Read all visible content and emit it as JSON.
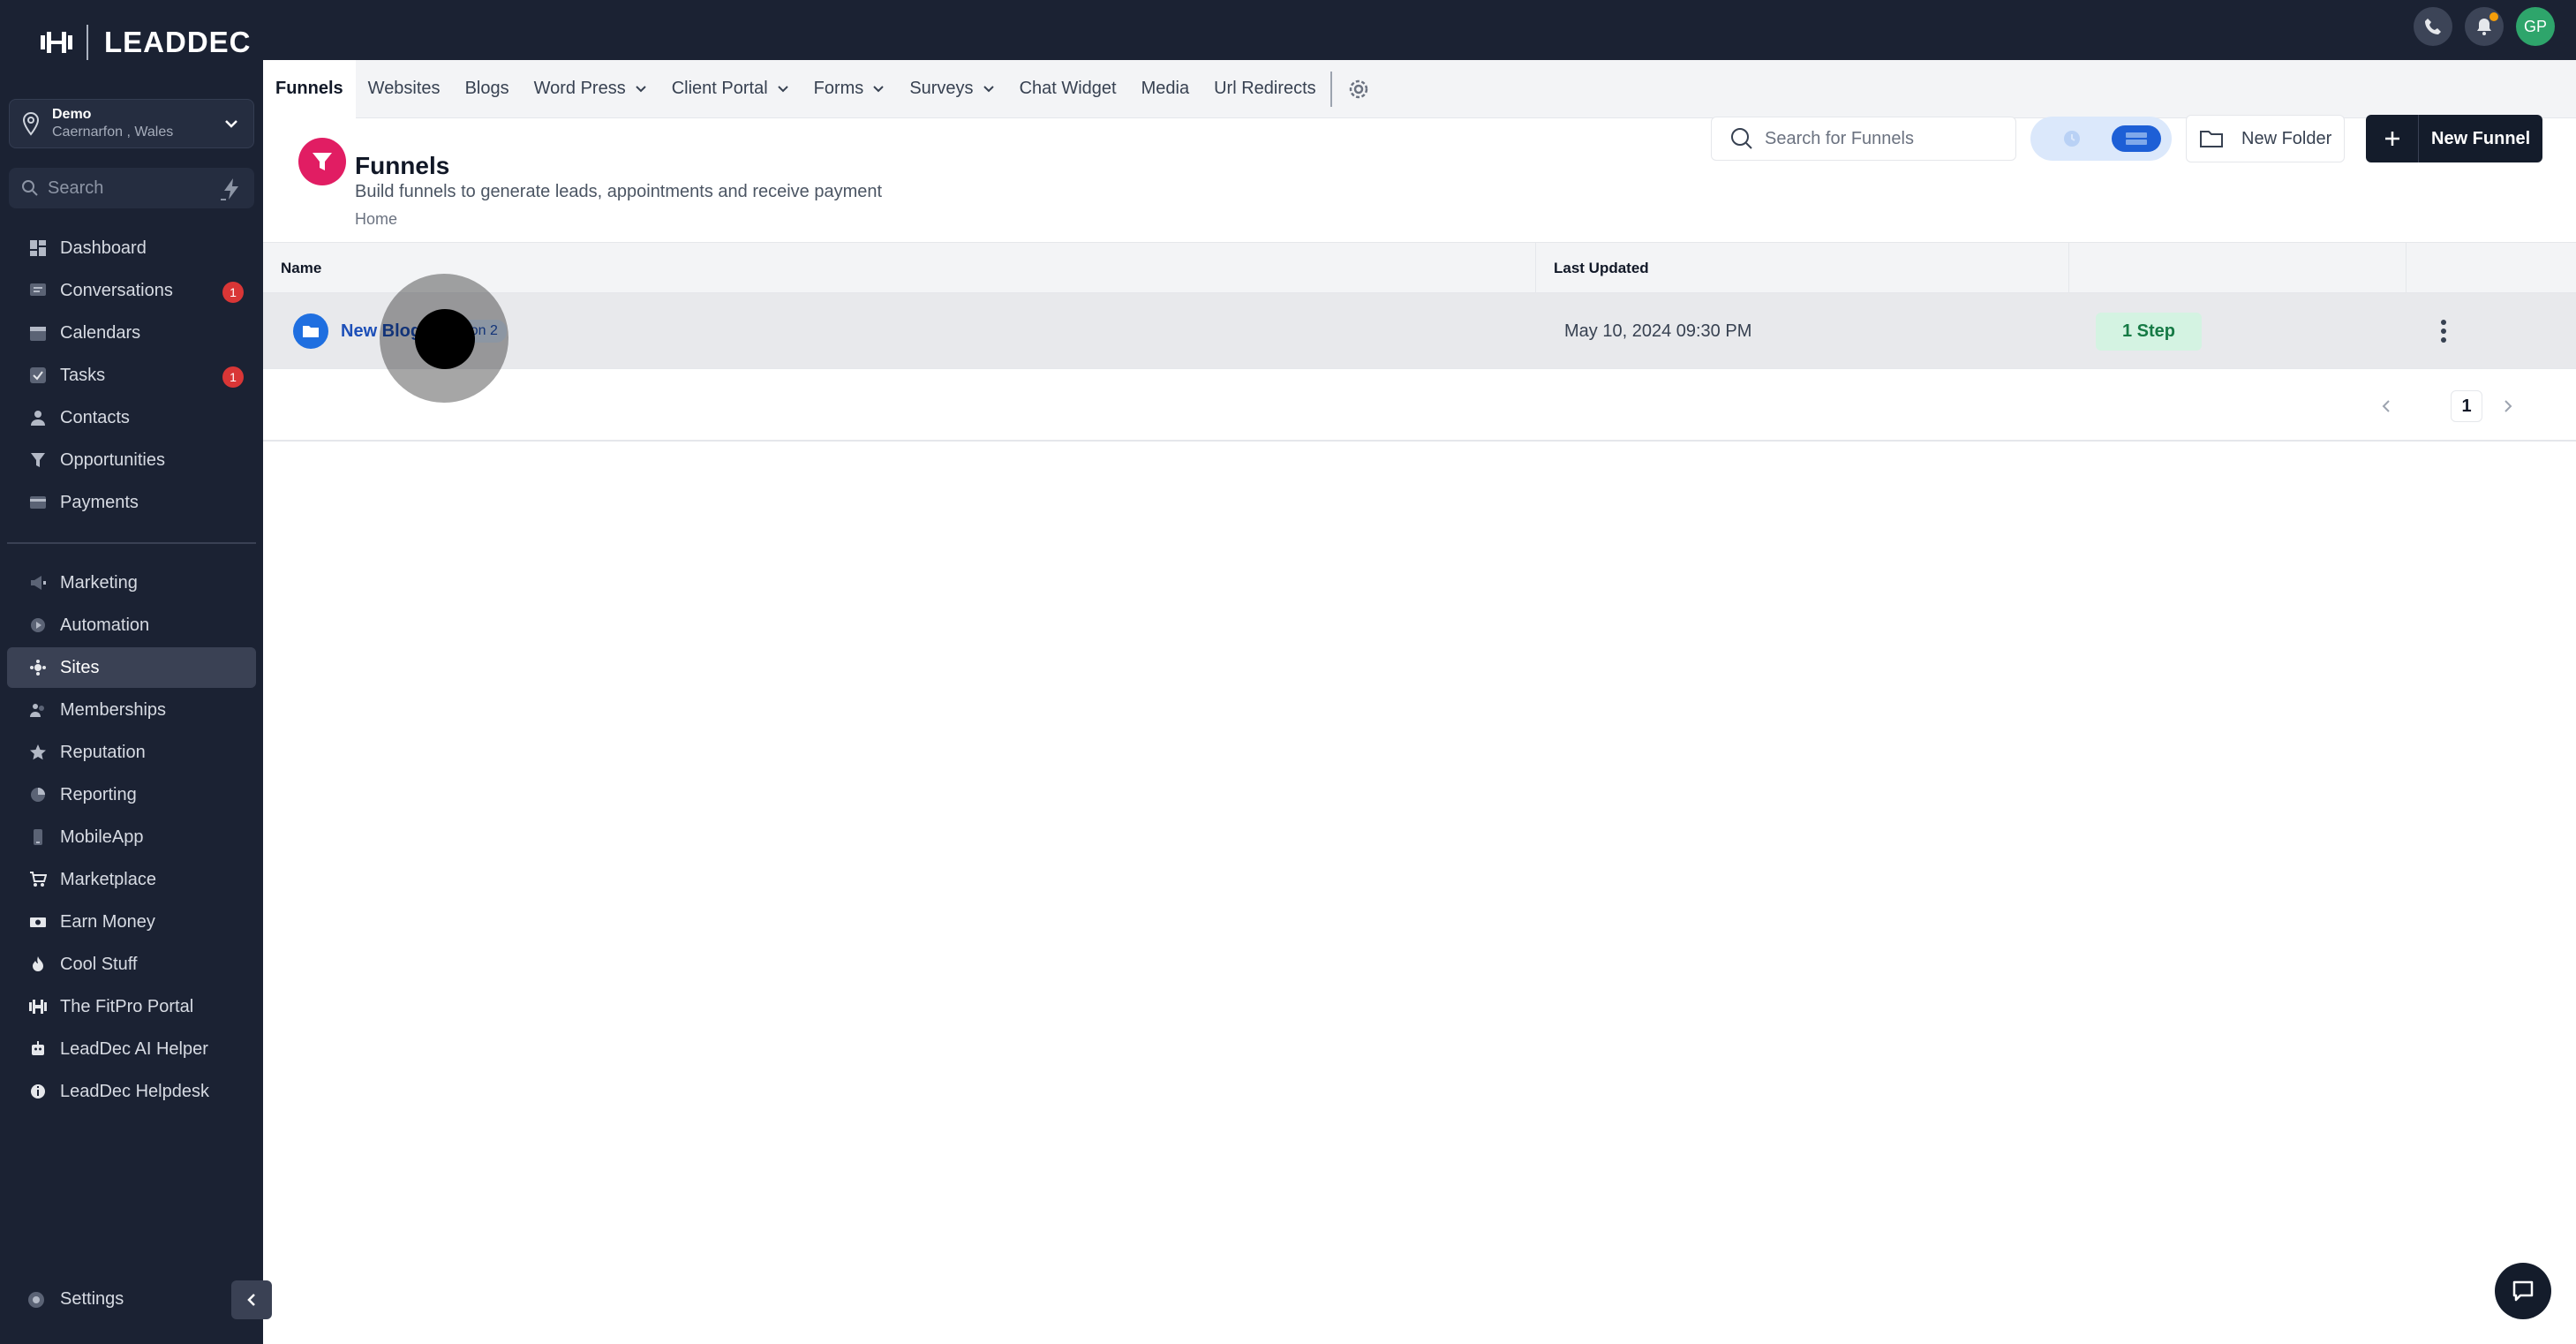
{
  "brand": {
    "name": "LEADDEC"
  },
  "location": {
    "name": "Demo",
    "address": "Caernarfon , Wales"
  },
  "sidebar_search": {
    "placeholder": "Search"
  },
  "sidebar": {
    "items": [
      {
        "label": "Dashboard",
        "icon": "dashboard-icon"
      },
      {
        "label": "Conversations",
        "icon": "chat-icon",
        "badge": "1"
      },
      {
        "label": "Calendars",
        "icon": "calendar-icon"
      },
      {
        "label": "Tasks",
        "icon": "check-icon",
        "badge": "1"
      },
      {
        "label": "Contacts",
        "icon": "person-icon"
      },
      {
        "label": "Opportunities",
        "icon": "funnel-icon"
      },
      {
        "label": "Payments",
        "icon": "card-icon"
      }
    ],
    "items2": [
      {
        "label": "Marketing",
        "icon": "megaphone-icon"
      },
      {
        "label": "Automation",
        "icon": "automation-icon"
      },
      {
        "label": "Sites",
        "icon": "sites-icon",
        "active": true
      },
      {
        "label": "Memberships",
        "icon": "members-icon"
      },
      {
        "label": "Reputation",
        "icon": "star-icon"
      },
      {
        "label": "Reporting",
        "icon": "chart-icon"
      },
      {
        "label": "MobileApp",
        "icon": "phone-icon"
      },
      {
        "label": "Marketplace",
        "icon": "cart-icon"
      },
      {
        "label": "Earn Money",
        "icon": "money-icon"
      },
      {
        "label": "Cool Stuff",
        "icon": "flame-icon"
      },
      {
        "label": "The FitPro Portal",
        "icon": "dumbbell-icon"
      },
      {
        "label": "LeadDec AI Helper",
        "icon": "robot-icon"
      },
      {
        "label": "LeadDec Helpdesk",
        "icon": "info-icon"
      }
    ],
    "settings_label": "Settings"
  },
  "topbar": {
    "avatar_initials": "GP"
  },
  "subnav": {
    "tabs": [
      {
        "label": "Funnels",
        "active": true
      },
      {
        "label": "Websites"
      },
      {
        "label": "Blogs"
      },
      {
        "label": "Word Press",
        "dropdown": true
      },
      {
        "label": "Client Portal",
        "dropdown": true
      },
      {
        "label": "Forms",
        "dropdown": true
      },
      {
        "label": "Surveys",
        "dropdown": true
      },
      {
        "label": "Chat Widget"
      },
      {
        "label": "Media"
      },
      {
        "label": "Url Redirects"
      }
    ]
  },
  "page": {
    "title": "Funnels",
    "subtitle": "Build funnels to generate leads, appointments and receive payment",
    "breadcrumb": "Home"
  },
  "search": {
    "placeholder": "Search for Funnels"
  },
  "actions": {
    "new_folder": "New Folder",
    "new_funnel": "New Funnel"
  },
  "table": {
    "headers": {
      "name": "Name",
      "last_updated": "Last Updated"
    },
    "rows": [
      {
        "name": "New Blog",
        "tag": "Version 2",
        "updated": "May 10, 2024 09:30 PM",
        "steps": "1 Step"
      }
    ]
  },
  "pagination": {
    "current": "1"
  },
  "colors": {
    "sidebar_bg": "#1b2233",
    "accent": "#1d5fd6",
    "brand_pink": "#e11d63",
    "step_green": "#167a45"
  }
}
